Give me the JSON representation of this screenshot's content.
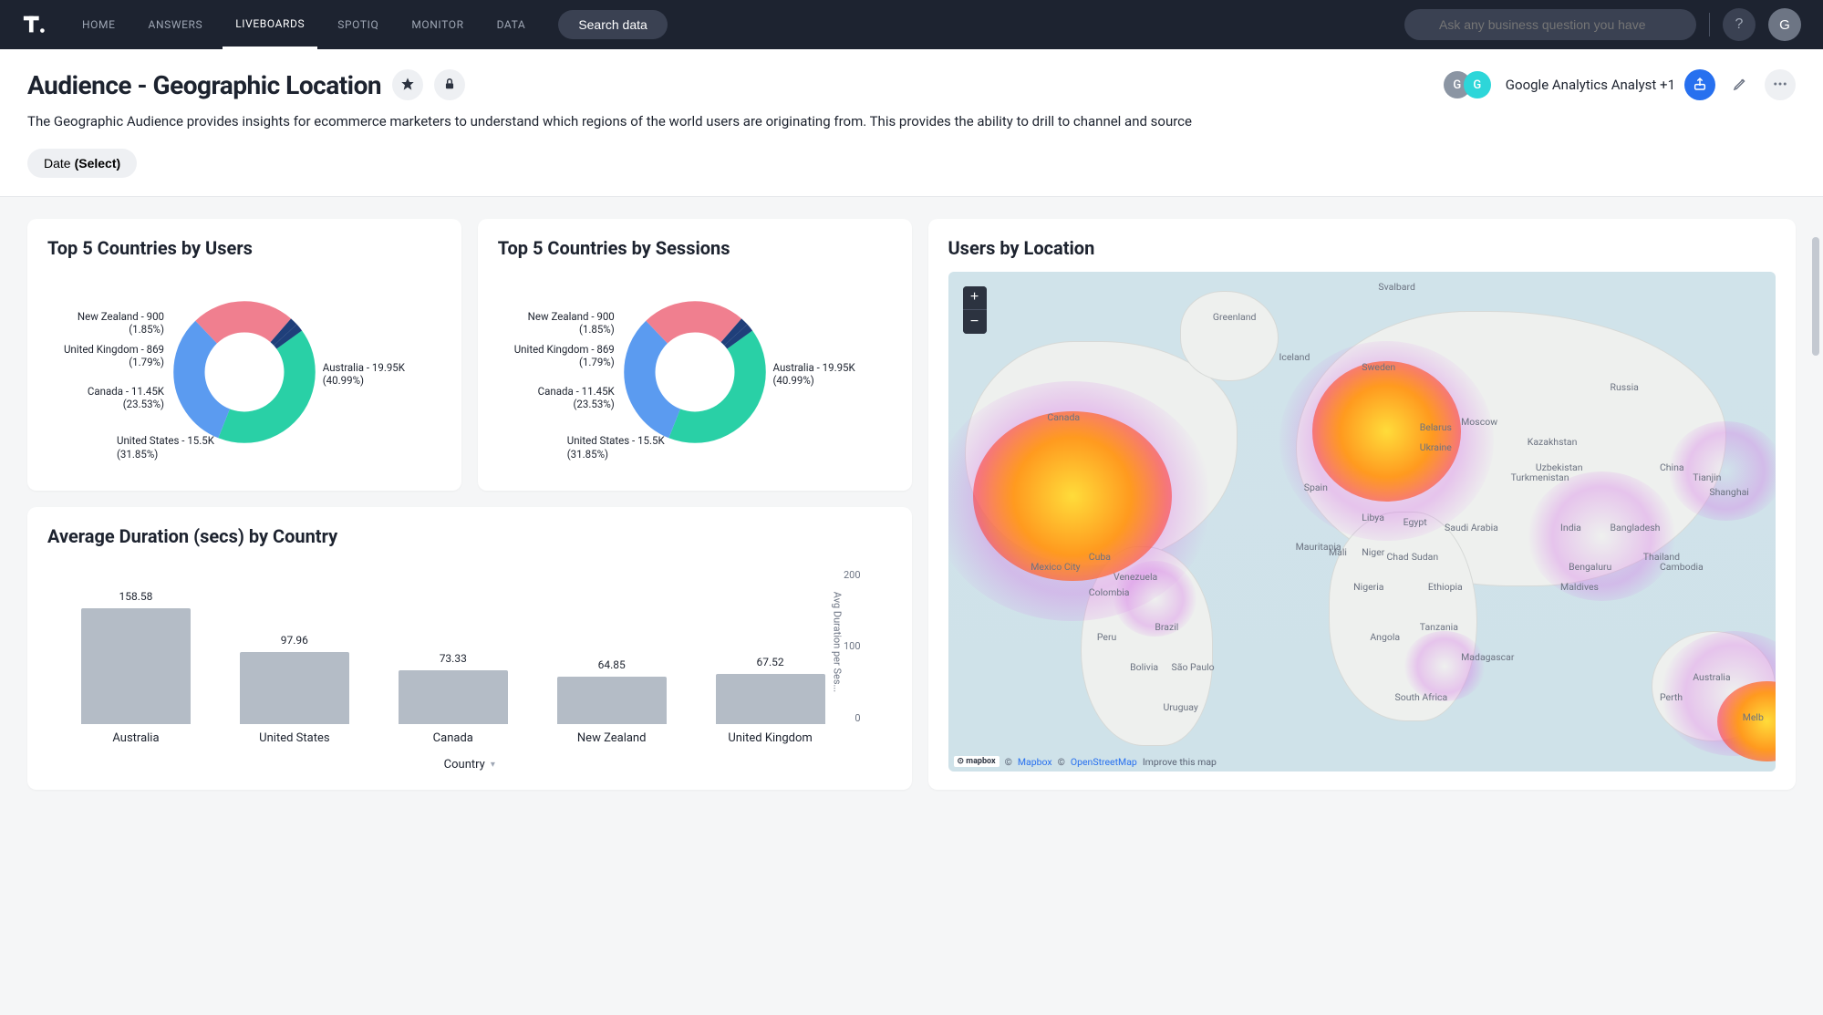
{
  "nav": {
    "items": [
      "HOME",
      "ANSWERS",
      "LIVEBOARDS",
      "SPOTIQ",
      "MONITOR",
      "DATA"
    ],
    "active": "LIVEBOARDS",
    "search_data_btn": "Search data",
    "ask_placeholder": "Ask any business question you have",
    "help_label": "?",
    "user_initial": "G"
  },
  "header": {
    "title": "Audience - Geographic Location",
    "description": "The Geographic Audience provides insights for ecommerce marketers to understand which regions of the world users are originating from. This provides the ability to drill to channel and source",
    "shared_with_label": "Google Analytics Analyst +1",
    "avatar_initials": [
      "G",
      "G"
    ],
    "avatar_colors": [
      "#8b95a3",
      "#2dd6d9"
    ],
    "filter_chip_label": "Date",
    "filter_chip_value": "(Select)"
  },
  "cards": {
    "donut_users": {
      "title": "Top 5 Countries by Users",
      "labels": {
        "nz": "New Zealand - 900 (1.85%)",
        "uk": "United Kingdom - 869 (1.79%)",
        "ca": "Canada - 11.45K (23.53%)",
        "us": "United States - 15.5K (31.85%)",
        "au": "Australia - 19.95K (40.99%)"
      }
    },
    "donut_sessions": {
      "title": "Top 5 Countries by Sessions",
      "labels": {
        "nz": "New Zealand - 900 (1.85%)",
        "uk": "United Kingdom - 869 (1.79%)",
        "ca": "Canada - 11.45K (23.53%)",
        "us": "United States - 15.5K (31.85%)",
        "au": "Australia - 19.95K (40.99%)"
      }
    },
    "bar": {
      "title": "Average Duration (secs) by Country",
      "ylabel": "Avg Duration per Ses...",
      "xlabel": "Country",
      "y_ticks": [
        "200",
        "100",
        "0"
      ]
    },
    "map": {
      "title": "Users by Location",
      "attribution_mapbox": "Mapbox",
      "attribution_osm": "OpenStreetMap",
      "attribution_improve": "Improve this map",
      "places": [
        "Greenland",
        "Iceland",
        "Russia",
        "Canada",
        "Moscow",
        "Kazakhstan",
        "China",
        "Shanghai",
        "Tianjin",
        "Libya",
        "Egypt",
        "Saudi Arabia",
        "India",
        "Bangladesh",
        "Mauritania",
        "Mali",
        "Niger",
        "Chad",
        "Sudan",
        "Bengaluru",
        "Thailand",
        "Cambodia",
        "Mexico City",
        "Cuba",
        "Venezuela",
        "Colombia",
        "Nigeria",
        "Ethiopia",
        "Maldives",
        "Peru",
        "Brazil",
        "São Paulo",
        "Angola",
        "Tanzania",
        "Madagascar",
        "Bolivia",
        "South Africa",
        "Uruguay",
        "Australia",
        "Perth",
        "Melb",
        "Ukraine",
        "Belarus",
        "Turkmenistan",
        "Uzbekistan",
        "Sweden",
        "Spain",
        "Svalbard"
      ]
    }
  },
  "chart_data": [
    {
      "type": "pie",
      "title": "Top 5 Countries by Users",
      "series": [
        {
          "name": "Australia",
          "value": 19950,
          "pct": 40.99,
          "color": "#29d0a6"
        },
        {
          "name": "United States",
          "value": 15500,
          "pct": 31.85,
          "color": "#5b9bf0"
        },
        {
          "name": "Canada",
          "value": 11450,
          "pct": 23.53,
          "color": "#f07f8f"
        },
        {
          "name": "New Zealand",
          "value": 900,
          "pct": 1.85,
          "color": "#1f3f7a"
        },
        {
          "name": "United Kingdom",
          "value": 869,
          "pct": 1.79,
          "color": "#1f3f7a"
        }
      ]
    },
    {
      "type": "pie",
      "title": "Top 5 Countries by Sessions",
      "series": [
        {
          "name": "Australia",
          "value": 19950,
          "pct": 40.99,
          "color": "#29d0a6"
        },
        {
          "name": "United States",
          "value": 15500,
          "pct": 31.85,
          "color": "#5b9bf0"
        },
        {
          "name": "Canada",
          "value": 11450,
          "pct": 23.53,
          "color": "#f07f8f"
        },
        {
          "name": "New Zealand",
          "value": 900,
          "pct": 1.85,
          "color": "#1f3f7a"
        },
        {
          "name": "United Kingdom",
          "value": 869,
          "pct": 1.79,
          "color": "#1f3f7a"
        }
      ]
    },
    {
      "type": "bar",
      "title": "Average Duration (secs) by Country",
      "categories": [
        "Australia",
        "United States",
        "Canada",
        "New Zealand",
        "United Kingdom"
      ],
      "values": [
        158.58,
        97.96,
        73.33,
        64.85,
        67.52
      ],
      "ylim": [
        0,
        200
      ],
      "ylabel": "Avg Duration per Ses...",
      "xlabel": "Country"
    }
  ]
}
